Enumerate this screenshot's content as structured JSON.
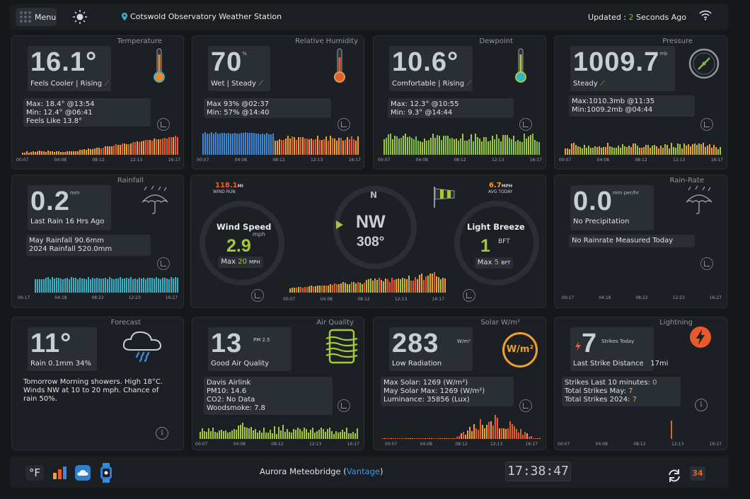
{
  "header": {
    "menu_label": "Menu",
    "station_name": "Cotswold Observatory Weather Station",
    "updated_prefix": "Updated : ",
    "updated_value": "2",
    "updated_suffix": " Seconds Ago"
  },
  "temperature": {
    "title": "Temperature",
    "value": "16.1°",
    "status": "Feels Cooler | Rising",
    "stats": [
      "Max: 18.4° @13:54",
      "Min: 12.4° @06:41",
      "Feels Like 13.8°"
    ],
    "ticks": [
      "00:07",
      "04:08",
      "08:12",
      "12:13",
      "16:17"
    ]
  },
  "humidity": {
    "title": "Relative Humidity",
    "value": "70",
    "unit": "%",
    "status": "Wet | Steady",
    "stats": [
      "Max 93% @02:37",
      "Min: 57% @14:40"
    ],
    "ticks": [
      "00:07",
      "04:08",
      "08:12",
      "12:13",
      "16:17"
    ]
  },
  "dewpoint": {
    "title": "Dewpoint",
    "value": "10.6°",
    "status": "Comfortable | Rising",
    "stats": [
      "Max: 12.3° @10:55",
      "Min: 9.3° @14:44"
    ],
    "ticks": [
      "00:07",
      "04:08",
      "08:12",
      "12:13",
      "16:17"
    ]
  },
  "pressure": {
    "title": "Pressure",
    "value": "1009.7",
    "unit": "mb",
    "status": "Steady",
    "stats": [
      "Max:1010.3mb @11:35",
      "Min:1009.2mb @04:44"
    ],
    "ticks": [
      "00:07",
      "04:08",
      "08:12",
      "12:13",
      "16:17"
    ]
  },
  "rainfall": {
    "title": "Rainfall",
    "value": "0.2",
    "unit": "mm",
    "status": "Last Rain 16 Hrs Ago",
    "stats": [
      "May Rainfall 90.6mm",
      "2024 Rainfall 520.0mm"
    ],
    "ticks": [
      "00:17",
      "04:18",
      "08:22",
      "12:23",
      "16:27"
    ]
  },
  "wind": {
    "run_value": "118.1",
    "run_unit": "MI",
    "run_label": "WIND RUN",
    "avg_value": "6.7",
    "avg_unit": "MPH",
    "avg_label": "AVG TODAY",
    "speed_label": "Wind Speed",
    "speed_unit": "mph",
    "speed_value": "2.9",
    "speed_max_label": "Max",
    "speed_max_value": "20",
    "speed_max_unit": "MPH",
    "compass_n": "N",
    "direction": "NW",
    "degrees": "308°",
    "beaufort_label": "Light Breeze",
    "beaufort_value": "1",
    "beaufort_unit": "BFT",
    "beaufort_max_label": "Max",
    "beaufort_max_value": "5",
    "beaufort_max_unit": "BFT",
    "ticks": [
      "00:07",
      "04:08",
      "08:12",
      "12:13",
      "16:17"
    ]
  },
  "rainrate": {
    "title": "Rain-Rate",
    "value": "0.0",
    "unit": "mm per/hr",
    "status": "No Precipitation",
    "stats": [
      "No Rainrate Measured Today"
    ],
    "ticks": [
      "00:17",
      "04:18",
      "08:22",
      "12:23",
      "16:27"
    ]
  },
  "forecast": {
    "title": "Forecast",
    "value": "11°",
    "status": "Rain 0.1mm 34%",
    "text": "Tomorrow Morning showers. High 18°C. Winds NW at 10 to 20 mph. Chance of rain 50%."
  },
  "air": {
    "title": "Air Quality",
    "value": "13",
    "unit": "PM 2.5",
    "status": "Good Air Quality",
    "stats": [
      "Davis Airlink",
      "PM10: 14.6",
      "CO2: No Data",
      "Woodsmoke: 7.8"
    ],
    "ticks": [
      "00:07",
      "04:08",
      "08:12",
      "12:13",
      "16:17"
    ]
  },
  "solar": {
    "title": "Solar W/m²",
    "value": "283",
    "unit": "W/m²",
    "badge": "W/m²",
    "status": "Low Radiation",
    "stats": [
      "Max Solar: 1269 (W/m²)",
      "May Solar Max: 1269 (W/m²)",
      "Luminance: 35856 (Lux)"
    ],
    "ticks": [
      "00:07",
      "04:08",
      "08:12",
      "12:13",
      "16:17"
    ]
  },
  "lightning": {
    "title": "Lightning",
    "value": "7",
    "unit": "Strikes Today",
    "status": "Last Strike Distance",
    "distance": "17mi",
    "stat1_label": "Strikes Last 10 minutes: ",
    "stat1_value": "0",
    "stat2_label": "Total Strikes May: ",
    "stat2_value": "7",
    "stat3_label": "Total Strikes 2024: ",
    "stat3_value": "7",
    "ticks": [
      "00:07",
      "04:08",
      "08:12",
      "12:13",
      "16:17"
    ]
  },
  "footer": {
    "unit_toggle": "°F",
    "station_prefix": "Aurora Meteobridge (",
    "station_link": "Vantage",
    "station_suffix": ")",
    "clock": "17:38:47",
    "badge": "34"
  }
}
